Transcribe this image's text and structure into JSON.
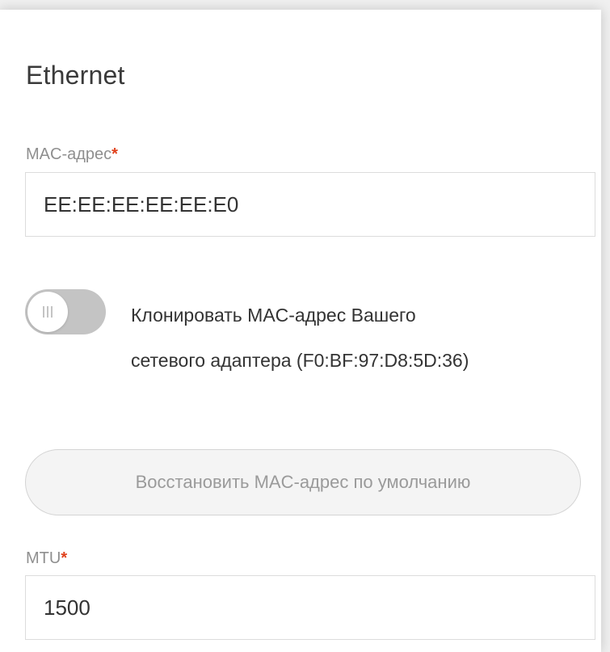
{
  "section": {
    "title": "Ethernet"
  },
  "mac": {
    "label": "MAC-адрес",
    "required_mark": "*",
    "value": "EE:EE:EE:EE:EE:E0"
  },
  "clone_toggle": {
    "state": "off",
    "label_line1": "Клонировать MAC-адрес Вашего",
    "label_line2": "сетевого адаптера (F0:BF:97:D8:5D:36)"
  },
  "restore_button": {
    "label": "Восстановить MAC-адрес по умолчанию",
    "state": "disabled"
  },
  "mtu": {
    "label": "MTU",
    "required_mark": "*",
    "value": "1500"
  },
  "colors": {
    "required": "#e0411c",
    "toggle_off": "#c4c4c4",
    "text": "#333333",
    "label": "#8f8f8f"
  }
}
